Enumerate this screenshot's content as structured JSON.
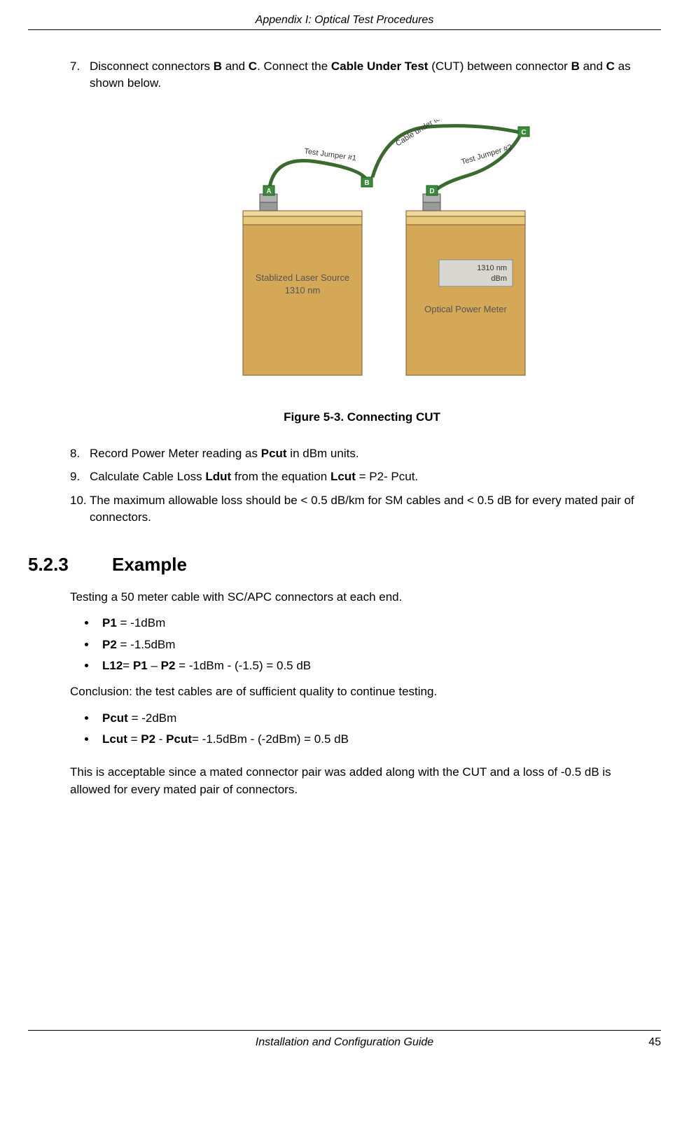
{
  "header": "Appendix I: Optical Test Procedures",
  "steps_first": [
    {
      "num": "7.",
      "html": "Disconnect connectors <b>B</b> and <b>C</b>. Connect the <b>Cable Under Test</b> (CUT) between connector <b>B</b> and <b>C</b> as shown below."
    }
  ],
  "figure": {
    "caption": "Figure 5-3. Connecting CUT",
    "labels": {
      "jumper1": "Test Jumper #1",
      "jumper2": "Test Jumper #2",
      "cut": "Cable under test",
      "source1": "Stablized Laser Source",
      "source2": "1310 nm",
      "meter_display1": "1310 nm",
      "meter_display2": "dBm",
      "meter_label": "Optical Power Meter",
      "A": "A",
      "B": "B",
      "C": "C",
      "D": "D"
    }
  },
  "steps_second": [
    {
      "num": "8.",
      "html": "Record Power Meter reading as <b>Pcut</b> in dBm units."
    },
    {
      "num": "9.",
      "html": "Calculate Cable Loss <b>Ldut</b> from the equation <b>Lcut</b> = P2- Pcut."
    },
    {
      "num": "10.",
      "html": "The maximum allowable loss should be < 0.5 dB/km for SM cables and < 0.5 dB for every mated pair of connectors."
    }
  ],
  "section": {
    "num": "5.2.3",
    "title": "Example"
  },
  "example_intro": "Testing a 50 meter cable with SC/APC connectors at each end.",
  "bullets1": [
    "<b>P1</b> = -1dBm",
    "<b>P2</b> = -1.5dBm",
    "<b>L12</b>= <b>P1</b> – <b>P2</b> = -1dBm - (-1.5) = 0.5 dB"
  ],
  "conclusion1": "Conclusion: the test cables are of sufficient quality to continue testing.",
  "bullets2": [
    "<b>Pcut</b> = -2dBm",
    "<b>Lcut</b> = <b>P2</b> - <b>Pcut</b>= -1.5dBm - (-2dBm) = 0.5 dB"
  ],
  "conclusion2": "This is acceptable since a mated connector pair was added along with the CUT and a loss of -0.5 dB is allowed for every mated pair of connectors.",
  "footer": {
    "center": "Installation and Configuration Guide",
    "right": "45"
  }
}
